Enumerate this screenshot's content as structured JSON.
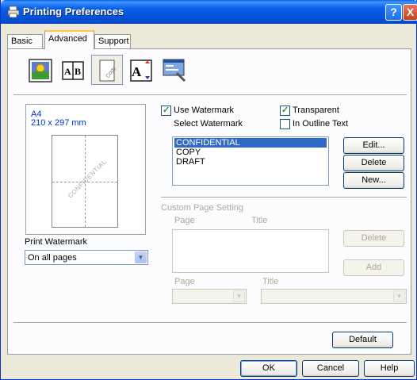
{
  "window": {
    "title": "Printing Preferences",
    "help_label": "?",
    "close_label": "X"
  },
  "tabs": [
    {
      "label": "Basic"
    },
    {
      "label": "Advanced"
    },
    {
      "label": "Support"
    }
  ],
  "toolbar": {
    "icons": [
      "print-quality-icon",
      "duplex-booklet-icon",
      "watermark-icon",
      "scaling-icon",
      "other-print-options-icon"
    ],
    "selected_index": 2
  },
  "preview": {
    "paper_name": "A4",
    "paper_dims": "210 x 297 mm",
    "watermark_text": "CONFIDENTIAL"
  },
  "print_watermark": {
    "label": "Print Watermark",
    "value": "On all pages"
  },
  "watermark": {
    "use_label": "Use Watermark",
    "use_checked": true,
    "transparent_label": "Transparent",
    "transparent_checked": true,
    "outline_label": "In Outline Text",
    "outline_checked": false,
    "select_label": "Select Watermark",
    "items": [
      "CONFIDENTIAL",
      "COPY",
      "DRAFT"
    ],
    "selected": "CONFIDENTIAL",
    "edit_label": "Edit...",
    "delete_label": "Delete",
    "new_label": "New..."
  },
  "custom_page": {
    "group_label": "Custom Page Setting",
    "page_col": "Page",
    "title_col": "Title",
    "delete_label": "Delete",
    "add_label": "Add",
    "page_label": "Page",
    "title_label": "Title"
  },
  "footer": {
    "default_label": "Default",
    "ok_label": "OK",
    "cancel_label": "Cancel",
    "help_label": "Help"
  }
}
